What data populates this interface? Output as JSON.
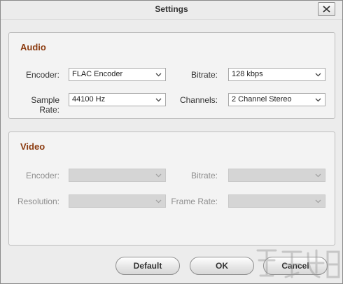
{
  "window": {
    "title": "Settings",
    "close_label": "✕"
  },
  "audio": {
    "title": "Audio",
    "encoder": {
      "label": "Encoder:",
      "value": "FLAC Encoder"
    },
    "bitrate": {
      "label": "Bitrate:",
      "value": "128 kbps"
    },
    "sample_rate": {
      "label": "Sample Rate:",
      "value": "44100 Hz"
    },
    "channels": {
      "label": "Channels:",
      "value": "2 Channel Stereo"
    }
  },
  "video": {
    "title": "Video",
    "encoder": {
      "label": "Encoder:",
      "value": ""
    },
    "bitrate": {
      "label": "Bitrate:",
      "value": ""
    },
    "resolution": {
      "label": "Resolution:",
      "value": ""
    },
    "frame_rate": {
      "label": "Frame Rate:",
      "value": ""
    }
  },
  "buttons": {
    "default": "Default",
    "ok": "OK",
    "cancel": "Cancel"
  },
  "colors": {
    "section_title": "#8b3a0e",
    "disabled_field": "#d5d5d5"
  }
}
